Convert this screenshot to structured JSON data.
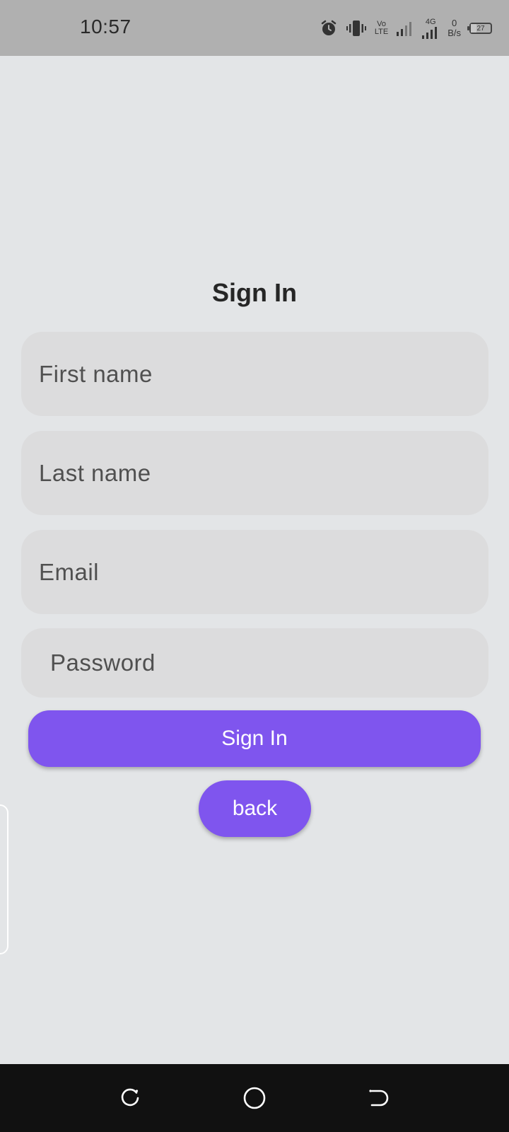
{
  "status_bar": {
    "time": "10:57",
    "network_top": "Vo",
    "network_bottom": "LTE",
    "network_gen": "4G",
    "speed_value": "0",
    "speed_unit": "B/s",
    "battery": "27",
    "battery_level": 0.27,
    "icons": [
      "alarm-icon",
      "vibrate-icon",
      "volte-icon",
      "signal-icon",
      "signal-4g-icon",
      "battery-icon"
    ]
  },
  "form": {
    "title": "Sign In",
    "first_name_placeholder": "First name",
    "last_name_placeholder": "Last name",
    "email_placeholder": "Email",
    "password_placeholder": "Password",
    "signin_label": "Sign In",
    "back_label": "back"
  },
  "colors": {
    "accent": "#7f55ee",
    "background": "#e3e5e7",
    "field_background": "#dcdcdd",
    "status_bar": "#b0b0b0",
    "nav_bar": "#111111"
  },
  "nav_bar": {
    "icons": [
      "recent-apps-icon",
      "home-icon",
      "back-icon"
    ]
  }
}
